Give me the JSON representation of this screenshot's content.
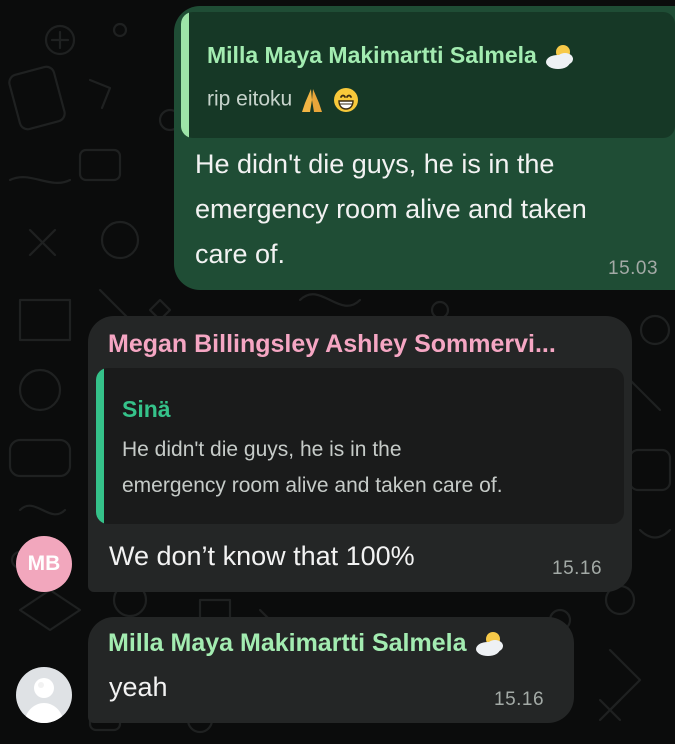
{
  "colors": {
    "outgoing_bubble": "#1f4d35",
    "incoming_bubble": "#242626",
    "name_green": "#a3ecb1",
    "name_pink": "#f5a6c3",
    "quote_bar_green": "#35c28a"
  },
  "messages": [
    {
      "direction": "outgoing",
      "quote": {
        "author": "Milla Maya Makimartti Salmela",
        "author_icon": "sun-behind-cloud-icon",
        "text": "rip eitoku",
        "emojis": [
          "folded-hands-icon",
          "grinning-face-icon"
        ]
      },
      "lines": [
        "He didn't die guys, he is in the",
        "emergency room alive and taken",
        "care of."
      ],
      "time": "15.03"
    },
    {
      "direction": "incoming",
      "sender": "Megan Billingsley Ashley Sommervi...",
      "quote": {
        "author": "Sinä",
        "lines": [
          "He didn't die guys, he is in the",
          "emergency room alive and taken care of."
        ]
      },
      "text": "We don’t know that 100%",
      "time": "15.16",
      "avatar_initials": "MB"
    },
    {
      "direction": "incoming",
      "sender": "Milla Maya Makimartti Salmela",
      "sender_icon": "sun-behind-cloud-icon",
      "text": "yeah",
      "time": "15.16",
      "avatar": "default-avatar-icon"
    }
  ]
}
